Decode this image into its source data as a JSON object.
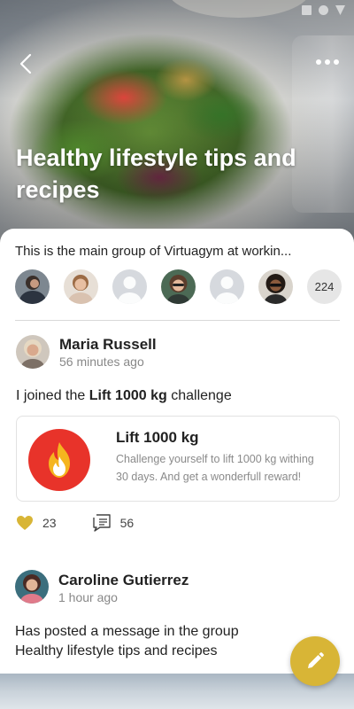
{
  "group": {
    "title": "Healthy lifestyle tips and recipes",
    "description": "This is the main group of Virtuagym at workin...",
    "member_count": "224"
  },
  "posts": [
    {
      "author": "Maria Russell",
      "time": "56 minutes ago",
      "text_prefix": "I joined the ",
      "text_bold": "Lift 1000 kg",
      "text_suffix": " challenge",
      "challenge": {
        "title": "Lift 1000 kg",
        "description": "Challenge yourself to lift 1000 kg withing 30 days. And get a wonderfull reward!",
        "icon": "flame-icon"
      },
      "likes": "23",
      "comments": "56"
    },
    {
      "author": "Caroline Gutierrez",
      "time": "1 hour ago",
      "text_line1": "Has posted a message in the group",
      "text_line2": "Healthy lifestyle tips and recipes"
    }
  ],
  "colors": {
    "accent": "#d8b536",
    "challenge_icon_bg": "#e8332a",
    "like": "#d8b536"
  },
  "icons": {
    "back": "chevron-left-icon",
    "more": "more-horizontal-icon",
    "like": "heart-icon",
    "comment": "comment-icon",
    "fab": "pencil-icon"
  }
}
